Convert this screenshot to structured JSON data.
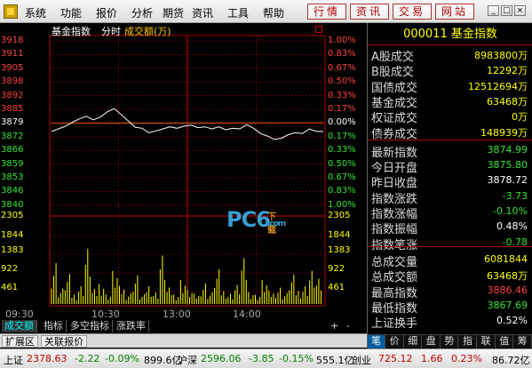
{
  "menu": {
    "items": [
      "系统",
      "功能",
      "报价",
      "分析",
      "期货",
      "资讯",
      "工具",
      "帮助"
    ],
    "nav_buttons": [
      "行情",
      "资讯",
      "交易",
      "网站"
    ],
    "win_buttons": [
      "_",
      "□",
      "×"
    ]
  },
  "chart": {
    "title": "基金指数",
    "period": "分时",
    "indicator": "成交额(万)",
    "close_icon": "close-square-icon",
    "price_labels_left": [
      "3918",
      "3911",
      "3905",
      "3898",
      "3892",
      "3885",
      "3879",
      "3872",
      "3866",
      "3859",
      "3853",
      "3846",
      "3840"
    ],
    "pct_labels_right": [
      "1.00%",
      "0.83%",
      "0.67%",
      "0.50%",
      "0.33%",
      "0.17%",
      "0.00%",
      "0.17%",
      "0.33%",
      "0.50%",
      "0.67%",
      "0.83%",
      "1.00%"
    ],
    "volume_labels": [
      "2305",
      "1844",
      "1383",
      "922",
      "461"
    ],
    "time_labels": [
      "09:30",
      "10:30",
      "13:00",
      "14:00"
    ],
    "colors": {
      "up": "#ff4040",
      "down": "#32e632",
      "grid": "#aa0000",
      "price_line": "#ffffff",
      "avg_line": "#ffff00",
      "volume": "#ffff00"
    }
  },
  "chart_data": {
    "type": "line",
    "title": "基金指数 分时",
    "x_label_ticks": [
      "09:30",
      "10:30",
      "13:00",
      "14:00"
    ],
    "ylim": [
      3840,
      3918
    ],
    "prev_close": 3878.72,
    "series": [
      {
        "values": [
          3874.99,
          3876.2,
          3877.5,
          3879.4,
          3881.0,
          3882.2,
          3880.5,
          3881.8,
          3884.3,
          3885.8,
          3883.0,
          3880.0,
          3877.0,
          3876.5,
          3874.4,
          3875.3,
          3876.2,
          3877.2,
          3876.5,
          3877.5,
          3878.0,
          3876.8,
          3877.2,
          3876.2,
          3877.2,
          3875.8,
          3876.5,
          3876.2,
          3878.2,
          3876.5,
          3874.0,
          3872.8,
          3871.2,
          3871.8,
          3873.5,
          3874.4,
          3874.0,
          3876.2,
          3875.0,
          3874.99
        ]
      }
    ],
    "volume_ylim": [
      0,
      2305
    ],
    "volume": [
      1200,
      420,
      760,
      300,
      520,
      1500,
      380,
      640,
      280,
      900,
      460,
      320,
      780,
      250,
      560,
      340,
      1320,
      420,
      300,
      700,
      380,
      260,
      600,
      320,
      880,
      410,
      300,
      520,
      1160,
      380,
      270,
      650,
      340,
      480,
      300,
      750,
      420,
      520,
      900,
      640
    ]
  },
  "tabs": {
    "row1": [
      "成交额",
      "指标",
      "多空指标",
      "涨跌率"
    ],
    "row1_controls": [
      "+",
      "-"
    ],
    "row2": [
      "扩展区",
      "关联报价"
    ]
  },
  "info": {
    "code": "000011",
    "name": "基金指数",
    "rows": [
      {
        "label": "A股成交",
        "value": "8983800万",
        "color": "#ffff00"
      },
      {
        "label": "B股成交",
        "value": "12292万",
        "color": "#ffff00"
      },
      {
        "label": "国债成交",
        "value": "12512694万",
        "color": "#ffff00"
      },
      {
        "label": "基金成交",
        "value": "63468万",
        "color": "#ffff00"
      },
      {
        "label": "权证成交",
        "value": "0万",
        "color": "#ffff00"
      },
      {
        "label": "债券成交",
        "value": "148939万",
        "color": "#ffff00"
      },
      {
        "label": "最新指数",
        "value": "3874.99",
        "color": "#32e632"
      },
      {
        "label": "今日开盘",
        "value": "3875.80",
        "color": "#32e632"
      },
      {
        "label": "昨日收盘",
        "value": "3878.72",
        "color": "#ffffff"
      },
      {
        "label": "指数涨跌",
        "value": "-3.73",
        "color": "#32e632"
      },
      {
        "label": "指数涨幅",
        "value": "-0.10%",
        "color": "#32e632"
      },
      {
        "label": "指数振幅",
        "value": "0.48%",
        "color": "#ffffff"
      },
      {
        "label": "指数笔涨",
        "value": "-0.78",
        "color": "#32e632"
      },
      {
        "label": "总成交量",
        "value": "6081844",
        "color": "#ffff00"
      },
      {
        "label": "总成交额",
        "value": "63468万",
        "color": "#ffff00"
      },
      {
        "label": "最高指数",
        "value": "3886.46",
        "color": "#ff4040"
      },
      {
        "label": "最低指数",
        "value": "3867.69",
        "color": "#32e632"
      },
      {
        "label": "上证换手",
        "value": "0.52%",
        "color": "#ffffff"
      }
    ],
    "side_tabs": [
      "笔",
      "价",
      "细",
      "盘",
      "势",
      "指",
      "联",
      "值",
      "筹"
    ]
  },
  "status": {
    "sh_label": "上证",
    "sh_value": "2378.63",
    "sh_change": "-2.22",
    "sh_pct": "-0.09%",
    "sh_amount": "899.6亿",
    "sz_label": "沪深",
    "sz_value": "2596.06",
    "sz_change": "-3.85",
    "sz_pct": "-0.15%",
    "sz_amount": "555.1亿",
    "cy_label": "创业",
    "cy_value": "725.12",
    "cy_change": "1.66",
    "cy_pct": "0.23%",
    "cy_amount": "86.72亿"
  }
}
